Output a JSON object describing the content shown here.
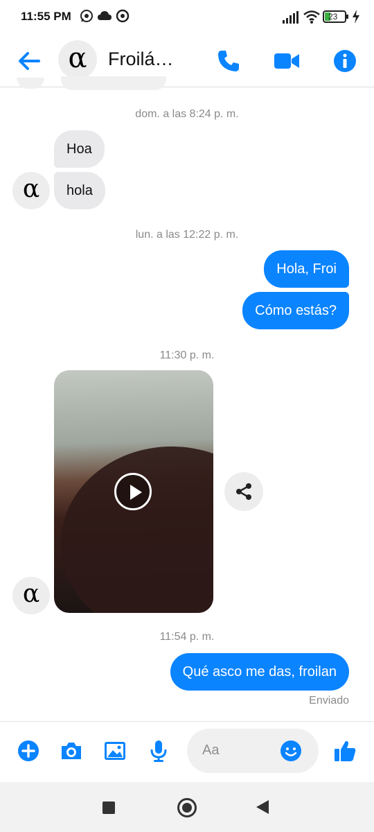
{
  "status_bar": {
    "time": "11:55 PM",
    "battery": "23"
  },
  "header": {
    "contact_name": "Froilá…",
    "avatar_glyph": "α"
  },
  "conversation": {
    "groups": [
      {
        "timestamp": "dom. a las 8:24 p. m.",
        "direction": "incoming",
        "messages": [
          "Hoa",
          "hola"
        ]
      },
      {
        "timestamp": "lun. a las 12:22 p. m.",
        "direction": "outgoing",
        "messages": [
          "Hola, Froi",
          "Cómo estás?"
        ]
      },
      {
        "timestamp": "11:30 p. m.",
        "direction": "incoming",
        "attachment": "video"
      },
      {
        "timestamp": "11:54 p. m.",
        "direction": "outgoing",
        "messages": [
          "Qué asco me das, froilan"
        ],
        "status": "Enviado"
      }
    ]
  },
  "composer": {
    "placeholder": "Aa"
  },
  "icons": {
    "accent": "#0a84ff",
    "outgoing_bubble": "#0a84ff",
    "incoming_bubble": "#e9e9eb"
  }
}
